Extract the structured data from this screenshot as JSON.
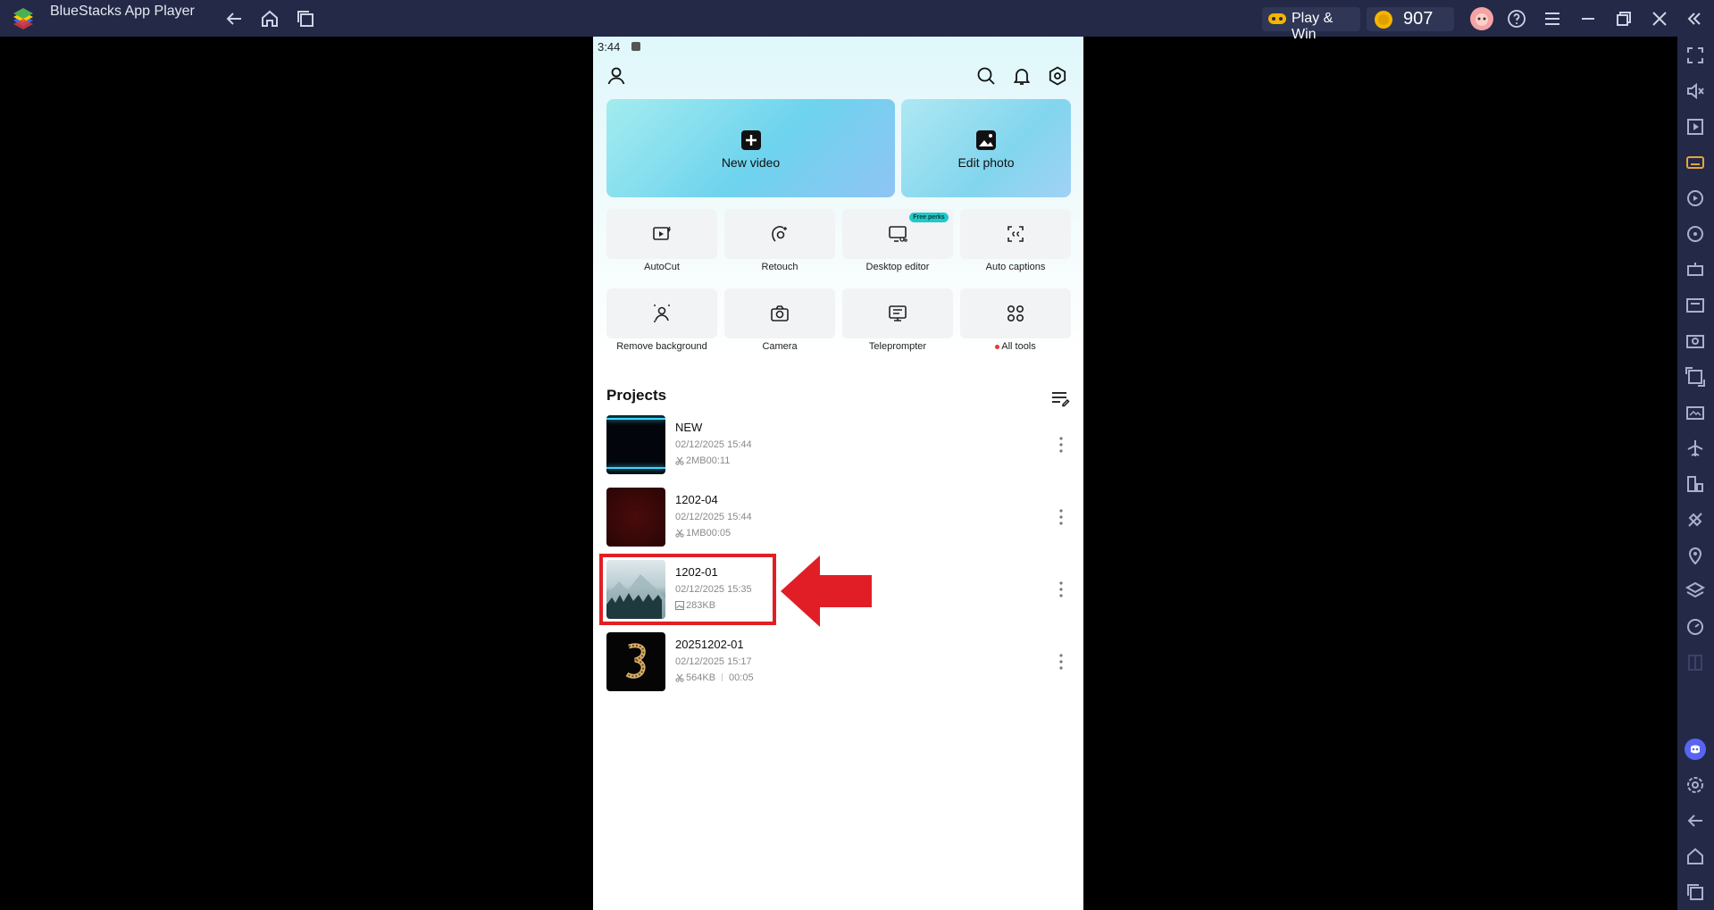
{
  "window": {
    "title": "BlueStacks App Player",
    "play_win": "Play & Win",
    "coins": "907"
  },
  "status": {
    "time": "3:44"
  },
  "actions": {
    "new_video": "New video",
    "edit_photo": "Edit photo"
  },
  "tools": [
    {
      "label": "AutoCut",
      "icon": "autocut-icon"
    },
    {
      "label": "Retouch",
      "icon": "retouch-icon"
    },
    {
      "label": "Desktop editor",
      "icon": "desktop-editor-icon",
      "badge": "Free perks"
    },
    {
      "label": "Auto captions",
      "icon": "auto-captions-icon"
    },
    {
      "label": "Remove background",
      "icon": "remove-background-icon"
    },
    {
      "label": "Camera",
      "icon": "camera-icon"
    },
    {
      "label": "Teleprompter",
      "icon": "teleprompter-icon"
    },
    {
      "label": "All tools",
      "icon": "all-tools-icon"
    }
  ],
  "projects": {
    "title": "Projects",
    "items": [
      {
        "name": "NEW",
        "date": "02/12/2025 15:44",
        "meta": "2MB00:11",
        "kind": "video"
      },
      {
        "name": "1202-04",
        "date": "02/12/2025 15:44",
        "meta": "1MB00:05",
        "kind": "video"
      },
      {
        "name": "1202-01",
        "date": "02/12/2025 15:35",
        "meta": "283KB",
        "kind": "photo"
      },
      {
        "name": "20251202-01",
        "date": "02/12/2025 15:17",
        "meta": "564KB",
        "meta2": "00:05",
        "kind": "video"
      }
    ]
  },
  "colors": {
    "accent": "#20c9c9",
    "highlight": "#e11e26",
    "titlebar": "#232947"
  }
}
